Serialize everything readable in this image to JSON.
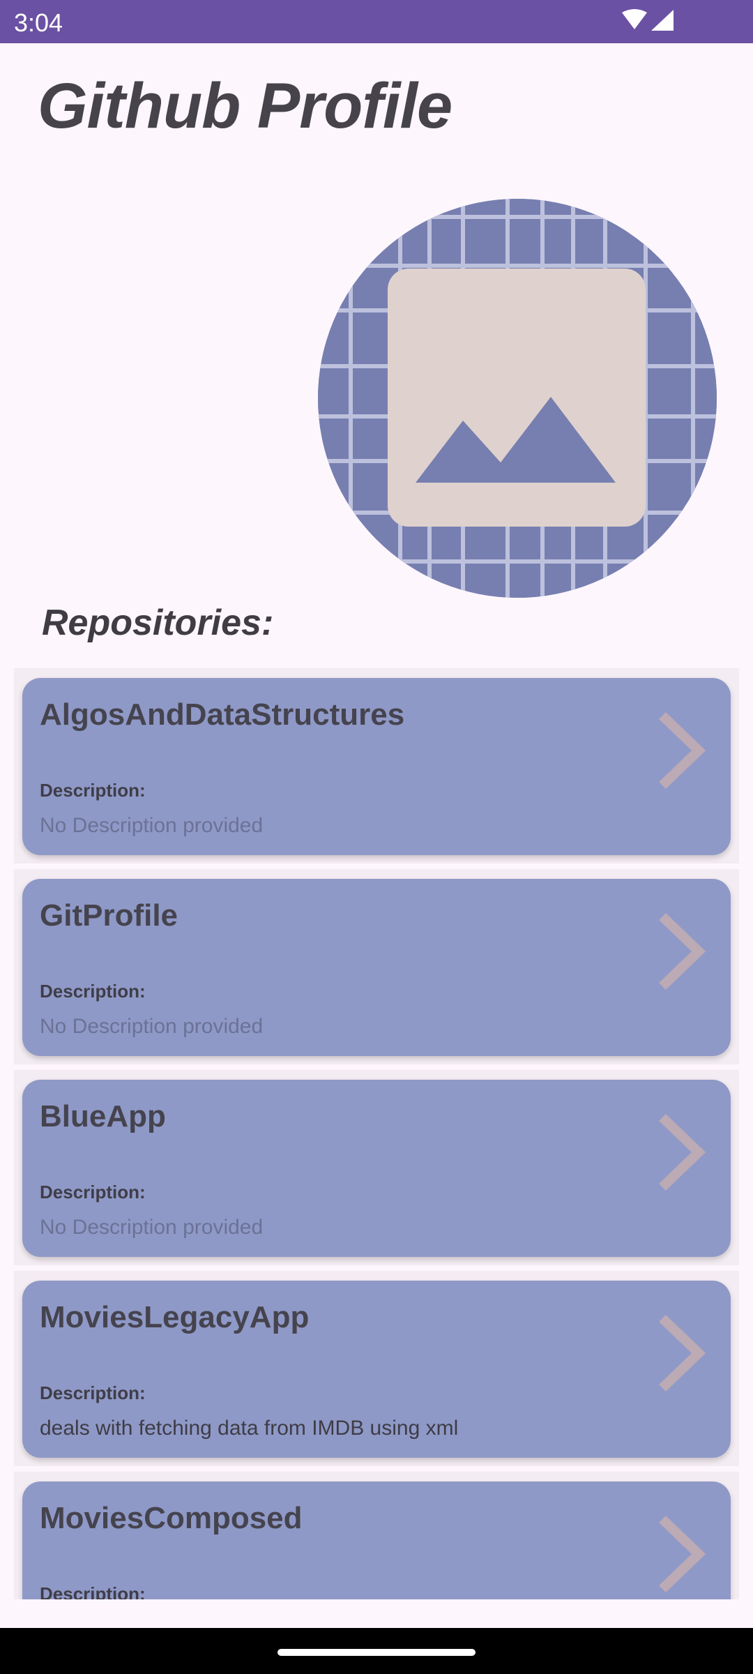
{
  "status_bar": {
    "time": "3:04"
  },
  "header": {
    "title": "Github Profile"
  },
  "profile": {
    "avatar_icon": "image-placeholder-icon"
  },
  "repositories": {
    "heading": "Repositories:",
    "items": [
      {
        "name": "AlgosAndDataStructures",
        "description_label": "Description:",
        "description": "No Description provided"
      },
      {
        "name": "GitProfile",
        "description_label": "Description:",
        "description": "No Description provided"
      },
      {
        "name": "BlueApp",
        "description_label": "Description:",
        "description": "No Description provided"
      },
      {
        "name": "MoviesLegacyApp",
        "description_label": "Description:",
        "description": "deals with fetching data from IMDB using xml"
      },
      {
        "name": "MoviesComposed",
        "description_label": "Description:",
        "description": ""
      }
    ]
  },
  "colors": {
    "status_bar": "#6A51A3",
    "background": "#FDF6FC",
    "card": "#8F99C7",
    "chevron": "#BCAAB5"
  }
}
